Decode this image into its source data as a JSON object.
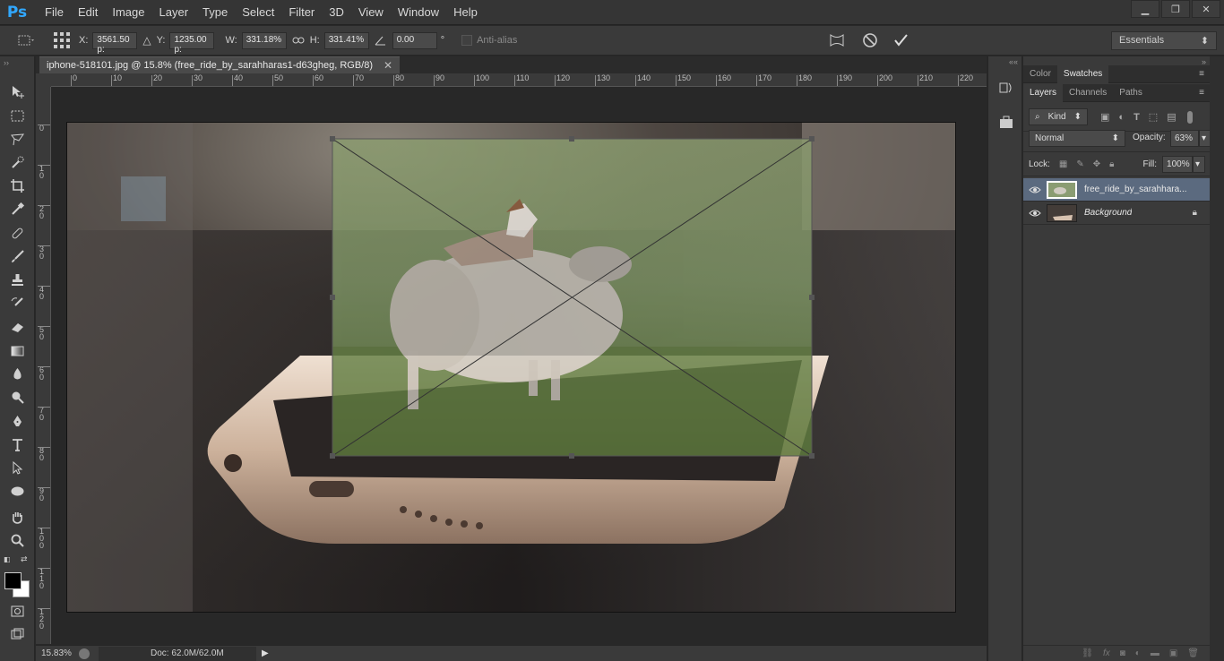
{
  "app": {
    "logo": "Ps"
  },
  "menu": [
    "File",
    "Edit",
    "Image",
    "Layer",
    "Type",
    "Select",
    "Filter",
    "3D",
    "View",
    "Window",
    "Help"
  ],
  "window_controls": {
    "minimize": "▁",
    "restore": "❐",
    "close": "✕"
  },
  "options": {
    "x_label": "X:",
    "x_value": "3561.50 p:",
    "y_label": "Y:",
    "y_value": "1235.00 p:",
    "w_label": "W:",
    "w_value": "331.18%",
    "h_label": "H:",
    "h_value": "331.41%",
    "angle_value": "0.00",
    "angle_unit": "°",
    "antialias_label": "Anti-alias",
    "workspace": "Essentials"
  },
  "document": {
    "tab_title": "iphone-518101.jpg @ 15.8% (free_ride_by_sarahharas1-d63gheg, RGB/8)",
    "close": "✕"
  },
  "ruler_h": [
    "0",
    "10",
    "20",
    "30",
    "40",
    "50",
    "60",
    "70",
    "80",
    "90",
    "100",
    "110",
    "120",
    "130",
    "140",
    "150",
    "160",
    "170",
    "180",
    "190",
    "200",
    "210",
    "220"
  ],
  "ruler_v": [
    "0",
    "1\n0",
    "2\n0",
    "3\n0",
    "4\n0",
    "5\n0",
    "6\n0",
    "7\n0",
    "8\n0",
    "9\n0",
    "1\n0\n0",
    "1\n1\n0",
    "1\n2\n0"
  ],
  "status": {
    "zoom": "15.83%",
    "doc": "Doc: 62.0M/62.0M"
  },
  "panels": {
    "top_tabs": [
      "Color",
      "Swatches"
    ],
    "layer_tabs": [
      "Layers",
      "Channels",
      "Paths"
    ],
    "kind_label": "Kind",
    "blend_mode": "Normal",
    "opacity_label": "Opacity:",
    "opacity_value": "63%",
    "lock_label": "Lock:",
    "fill_label": "Fill:",
    "fill_value": "100%",
    "layers": [
      {
        "name": "free_ride_by_sarahhara...",
        "selected": true
      },
      {
        "name": "Background",
        "selected": false
      }
    ]
  },
  "colors": {
    "accent": "#31a8ff",
    "selection": "#5b6a7f"
  }
}
